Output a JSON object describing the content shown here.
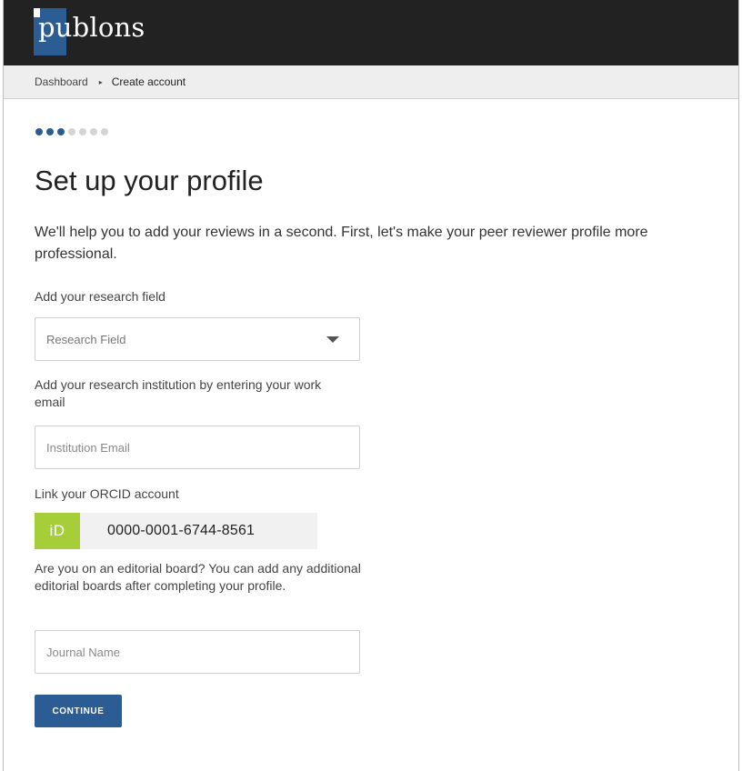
{
  "brand": {
    "logo_text": "publons"
  },
  "breadcrumb": {
    "items": [
      "Dashboard",
      "Create account"
    ],
    "separator": "▸"
  },
  "progress": {
    "total_steps": 7,
    "current_step": 3
  },
  "page": {
    "title": "Set up your profile",
    "intro": "We'll help you to add your reviews in a second. First, let's make your peer reviewer profile more professional."
  },
  "form": {
    "research_field": {
      "label": "Add your research field",
      "placeholder": "Research Field"
    },
    "institution": {
      "label": "Add your research institution by entering your work email",
      "placeholder": "Institution Email"
    },
    "orcid": {
      "label": "Link your ORCID account",
      "icon_text": "iD",
      "value": "0000-0001-6744-8561"
    },
    "editorial": {
      "label": "Are you on an editorial board? You can add any additional editorial boards after completing your profile.",
      "placeholder": "Journal Name"
    },
    "continue_label": "CONTINUE"
  },
  "colors": {
    "brand_blue": "#2b5d94",
    "header_bg": "#222222",
    "orcid_green": "#a6ce39"
  }
}
